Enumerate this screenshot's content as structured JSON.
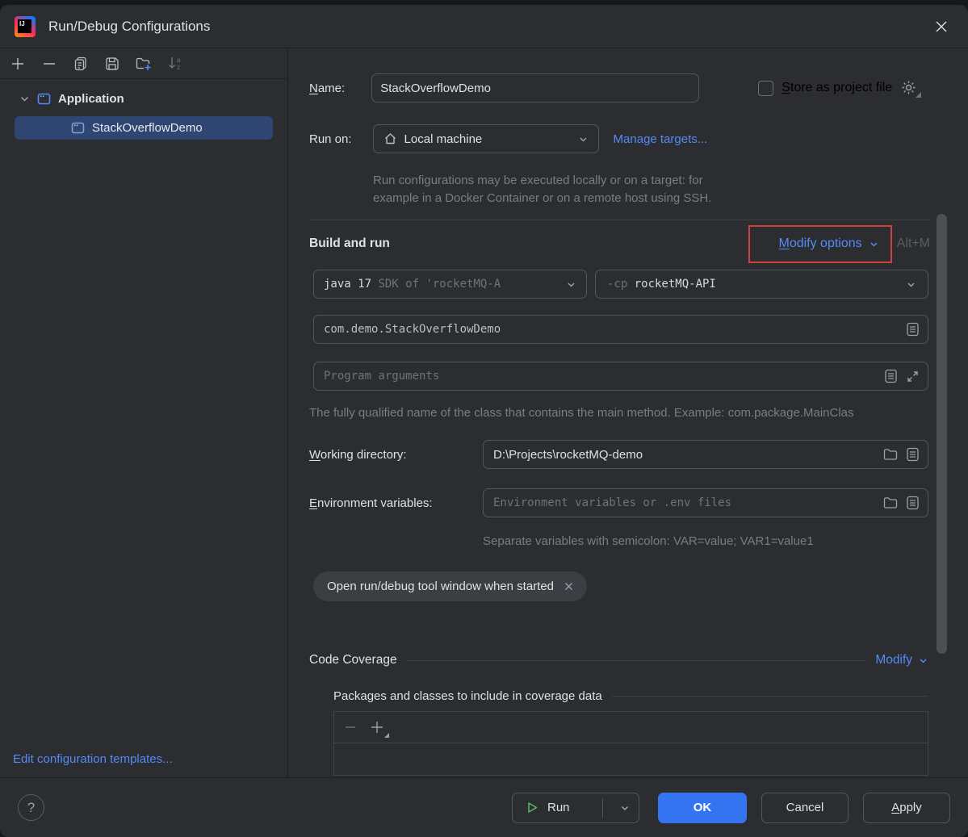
{
  "window": {
    "title": "Run/Debug Configurations"
  },
  "sidebar": {
    "tree": {
      "group_label": "Application",
      "item_label": "StackOverflowDemo"
    },
    "edit_templates": "Edit configuration templates..."
  },
  "form": {
    "name_label_mn": "N",
    "name_label_rest": "ame:",
    "name_value": "StackOverflowDemo",
    "store_label_mn": "S",
    "store_label_rest": "tore as project file",
    "run_on_label": "Run on:",
    "run_on_value": "Local machine",
    "manage_targets": "Manage targets...",
    "run_on_help_line1": "Run configurations may be executed locally or on a target: for",
    "run_on_help_line2": "example in a Docker Container or on a remote host using SSH.",
    "build_and_run_title": "Build and run",
    "modify_options_mn": "M",
    "modify_options_rest": "odify options",
    "modify_shortcut": "Alt+M",
    "jdk_primary": "java 17",
    "jdk_secondary": " SDK of 'rocketMQ-A",
    "cp_prefix": "-cp ",
    "cp_value": "rocketMQ-API",
    "main_class_value": "com.demo.StackOverflowDemo",
    "program_args_placeholder": "Program arguments",
    "main_class_help": "The fully qualified name of the class that contains the main method. Example: com.package.MainClas",
    "working_dir_label_mn": "W",
    "working_dir_label_rest": "orking directory:",
    "working_dir_value": "D:\\Projects\\rocketMQ-demo",
    "env_label_mn": "E",
    "env_label_rest": "nvironment variables:",
    "env_placeholder": "Environment variables or .env files",
    "env_help": "Separate variables with semicolon: VAR=value; VAR1=value1",
    "chip_label": "Open run/debug tool window when started",
    "coverage_title": "Code Coverage",
    "coverage_modify": "Modify",
    "coverage_packages_label": "Packages and classes to include in coverage data"
  },
  "footer": {
    "help": "?",
    "run_label": "Run",
    "ok_label": "OK",
    "cancel_label": "Cancel",
    "apply_label_mn": "A",
    "apply_label_rest": "pply"
  },
  "colors": {
    "accent": "#3574f0",
    "link": "#548af7",
    "annotation_red": "#d53b3b",
    "tree_selection": "#2f4673"
  }
}
